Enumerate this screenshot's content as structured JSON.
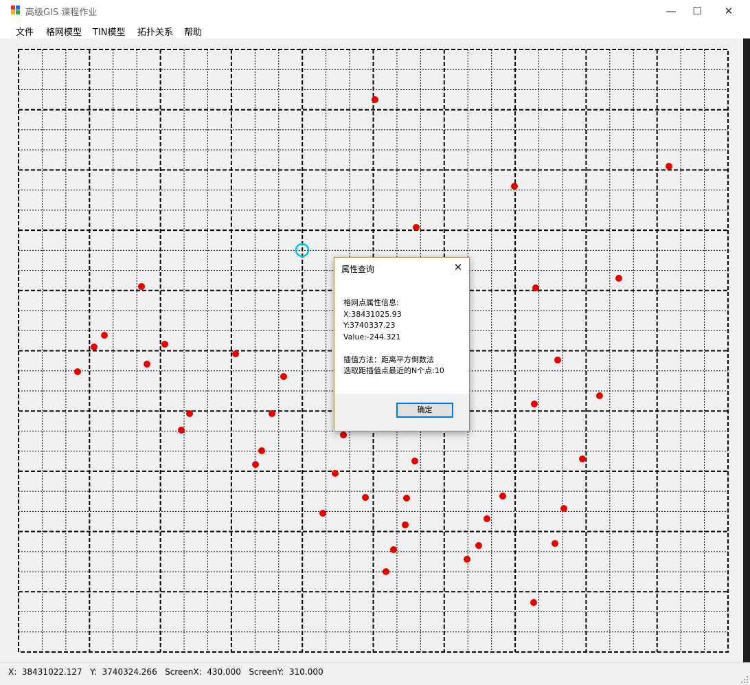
{
  "window": {
    "title": "高级GIS 课程作业",
    "minimize_glyph": "—",
    "maximize_glyph": "☐",
    "close_glyph": "✕"
  },
  "menu": [
    "文件",
    "格网模型",
    "TIN模型",
    "拓扑关系",
    "帮助"
  ],
  "status_bar": {
    "text": "X:  38431022.127   Y:  3740324.266   ScreenX:  430.000   ScreenY:  310.000"
  },
  "dialog": {
    "title": "属性查询",
    "close_glyph": "✕",
    "lines": [
      "格网点属性信息:",
      "X:38431025.93",
      "Y:3740337.23",
      "Value:-244.321",
      "",
      "插值方法：距离平方倒数法",
      "选取距插值点最近的N个点:10"
    ],
    "ok_label": "确定"
  },
  "colors": {
    "point": "#e60000",
    "cursor_ring": "#00c8e0",
    "grid_line": "#000000"
  },
  "icons": {
    "cursor_ring": "circle-cursor-icon",
    "app": "app-icon"
  }
}
